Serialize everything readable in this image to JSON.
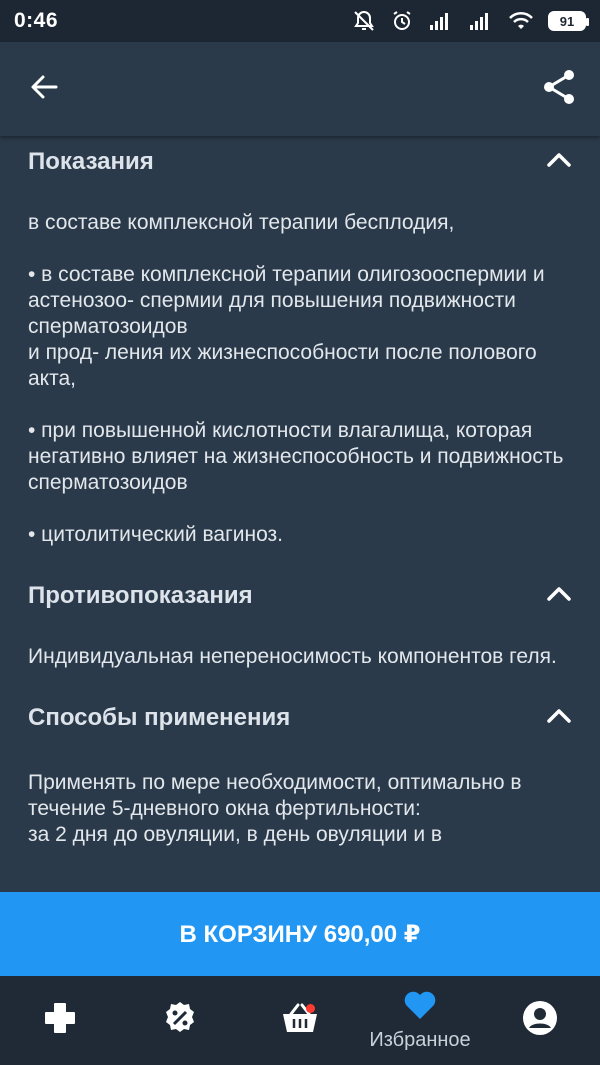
{
  "status_bar": {
    "time": "0:46",
    "battery": "91"
  },
  "app_bar": {
    "back_icon": "arrow-left-icon",
    "share_icon": "share-icon"
  },
  "sections": [
    {
      "title": "Показания",
      "expanded": true,
      "body": "в составе комплексной терапии бесплодия,\n\n•  в составе комплексной терапии олигозооспермии и астенозоо- спермии для повышения подвижности сперматозоидов\nи прод- ления их жизнеспособности после полового акта,\n\n• при повышенной кислотности влагалища, которая негативно влияет на жизнеспособность и подвижность сперматозоидов\n\n•  цитолитический вагиноз."
    },
    {
      "title": "Противопоказания",
      "expanded": true,
      "body": "Индивидуальная непереносимость компонентов геля."
    },
    {
      "title": "Способы применения",
      "expanded": true,
      "body": "Применять по мере необходимости, оптимально в течение 5-дневного окна фертильности:\nза 2 дня до овуляции, в день овуляции и в"
    }
  ],
  "cart_button": {
    "label": "В КОРЗИНУ 690,00 ₽"
  },
  "bottom_nav": {
    "items": [
      {
        "icon": "cross-icon",
        "label": ""
      },
      {
        "icon": "discount-icon",
        "label": ""
      },
      {
        "icon": "basket-icon",
        "label": ""
      },
      {
        "icon": "heart-icon",
        "label": "Избранное",
        "active": true
      },
      {
        "icon": "profile-icon",
        "label": ""
      }
    ]
  },
  "colors": {
    "background": "#2b3a4a",
    "status_bar": "#1c2733",
    "accent": "#2196f3",
    "nav_bar": "#1f2a36",
    "badge": "#ff3b30"
  }
}
